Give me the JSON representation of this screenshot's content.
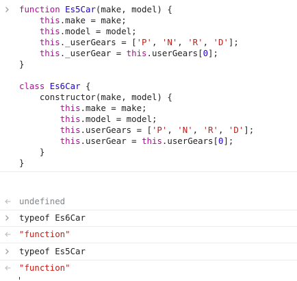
{
  "entries": [
    {
      "type": "input",
      "lines": [
        [
          {
            "t": "function ",
            "c": "kw"
          },
          {
            "t": "Es5Car",
            "c": "fn"
          },
          {
            "t": "(make, model) {",
            "c": "plain"
          }
        ],
        [
          {
            "t": "    ",
            "c": "plain"
          },
          {
            "t": "this",
            "c": "this"
          },
          {
            "t": ".make = make;",
            "c": "plain"
          }
        ],
        [
          {
            "t": "    ",
            "c": "plain"
          },
          {
            "t": "this",
            "c": "this"
          },
          {
            "t": ".model = model;",
            "c": "plain"
          }
        ],
        [
          {
            "t": "    ",
            "c": "plain"
          },
          {
            "t": "this",
            "c": "this"
          },
          {
            "t": "._userGears = [",
            "c": "plain"
          },
          {
            "t": "'P'",
            "c": "str"
          },
          {
            "t": ", ",
            "c": "plain"
          },
          {
            "t": "'N'",
            "c": "str"
          },
          {
            "t": ", ",
            "c": "plain"
          },
          {
            "t": "'R'",
            "c": "str"
          },
          {
            "t": ", ",
            "c": "plain"
          },
          {
            "t": "'D'",
            "c": "str"
          },
          {
            "t": "];",
            "c": "plain"
          }
        ],
        [
          {
            "t": "    ",
            "c": "plain"
          },
          {
            "t": "this",
            "c": "this"
          },
          {
            "t": "._userGear = ",
            "c": "plain"
          },
          {
            "t": "this",
            "c": "this"
          },
          {
            "t": ".userGears[",
            "c": "plain"
          },
          {
            "t": "0",
            "c": "num"
          },
          {
            "t": "];",
            "c": "plain"
          }
        ],
        [
          {
            "t": "}",
            "c": "plain"
          }
        ],
        [
          {
            "t": "",
            "c": "plain"
          }
        ],
        [
          {
            "t": "class ",
            "c": "kw"
          },
          {
            "t": "Es6Car",
            "c": "fn"
          },
          {
            "t": " {",
            "c": "plain"
          }
        ],
        [
          {
            "t": "    constructor(make, model) {",
            "c": "plain"
          }
        ],
        [
          {
            "t": "        ",
            "c": "plain"
          },
          {
            "t": "this",
            "c": "this"
          },
          {
            "t": ".make = make;",
            "c": "plain"
          }
        ],
        [
          {
            "t": "        ",
            "c": "plain"
          },
          {
            "t": "this",
            "c": "this"
          },
          {
            "t": ".model = model;",
            "c": "plain"
          }
        ],
        [
          {
            "t": "        ",
            "c": "plain"
          },
          {
            "t": "this",
            "c": "this"
          },
          {
            "t": ".userGears = [",
            "c": "plain"
          },
          {
            "t": "'P'",
            "c": "str"
          },
          {
            "t": ", ",
            "c": "plain"
          },
          {
            "t": "'N'",
            "c": "str"
          },
          {
            "t": ", ",
            "c": "plain"
          },
          {
            "t": "'R'",
            "c": "str"
          },
          {
            "t": ", ",
            "c": "plain"
          },
          {
            "t": "'D'",
            "c": "str"
          },
          {
            "t": "];",
            "c": "plain"
          }
        ],
        [
          {
            "t": "        ",
            "c": "plain"
          },
          {
            "t": "this",
            "c": "this"
          },
          {
            "t": ".userGear = ",
            "c": "plain"
          },
          {
            "t": "this",
            "c": "this"
          },
          {
            "t": ".userGears[",
            "c": "plain"
          },
          {
            "t": "0",
            "c": "num"
          },
          {
            "t": "];",
            "c": "plain"
          }
        ],
        [
          {
            "t": "    }",
            "c": "plain"
          }
        ],
        [
          {
            "t": "}",
            "c": "plain"
          }
        ]
      ]
    },
    {
      "type": "result",
      "text": "undefined",
      "style": "undef"
    },
    {
      "type": "input",
      "lines": [
        [
          {
            "t": "typeof Es6Car",
            "c": "plain"
          }
        ]
      ]
    },
    {
      "type": "result",
      "text": "\"function\"",
      "style": "str"
    },
    {
      "type": "input",
      "lines": [
        [
          {
            "t": "typeof Es5Car",
            "c": "plain"
          }
        ]
      ]
    },
    {
      "type": "result",
      "text": "\"function\"",
      "style": "str"
    }
  ],
  "icons": {
    "input_marker": "chevron-right-icon",
    "result_marker": "return-arrow-icon"
  }
}
